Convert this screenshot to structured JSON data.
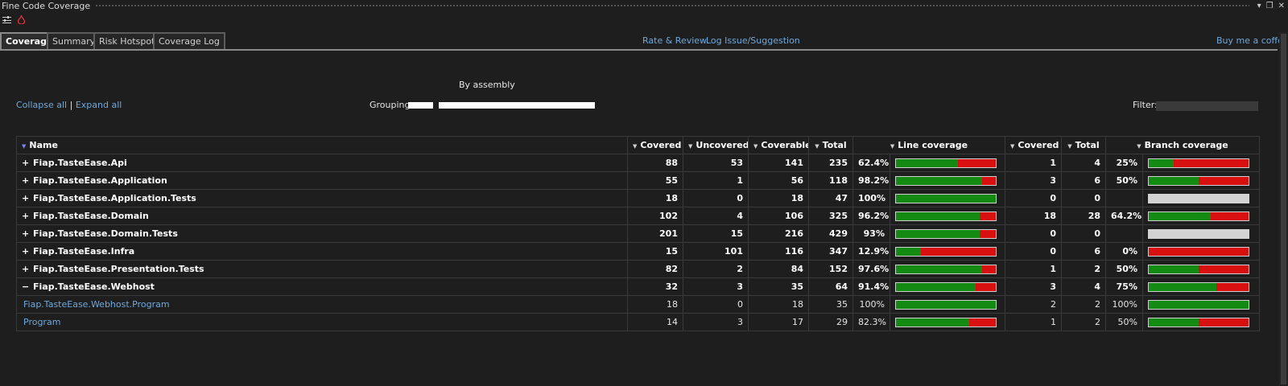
{
  "window": {
    "title": "Fine Code Coverage"
  },
  "tabs": [
    {
      "label": "Coverage",
      "active": true
    },
    {
      "label": "Summary"
    },
    {
      "label": "Risk Hotspots"
    },
    {
      "label": "Coverage Log"
    }
  ],
  "links": {
    "rate_review": "Rate & Review",
    "log_issue": "Log Issue/Suggestion",
    "buy_coffee": "Buy me a coffee"
  },
  "grouping": {
    "by_assembly": "By assembly",
    "collapse_all": "Collapse all",
    "separator": "|",
    "expand_all": "Expand all",
    "label": "Grouping:"
  },
  "filter": {
    "label": "Filter:"
  },
  "table": {
    "headers": {
      "name": "Name",
      "covered": "Covered",
      "uncovered": "Uncovered",
      "coverable": "Coverable",
      "total": "Total",
      "line_coverage": "Line coverage",
      "branch_covered": "Covered",
      "branch_total": "Total",
      "branch_coverage": "Branch coverage"
    },
    "rows": [
      {
        "type": "assembly",
        "expander": "+",
        "name": "Fiap.TasteEase.Api",
        "covered": "88",
        "uncovered": "53",
        "coverable": "141",
        "total": "235",
        "line_pct": "62.4%",
        "line_frac": 0.624,
        "br_covered": "1",
        "br_total": "4",
        "br_pct": "25%",
        "br_frac": 0.25
      },
      {
        "type": "assembly",
        "expander": "+",
        "name": "Fiap.TasteEase.Application",
        "covered": "55",
        "uncovered": "1",
        "coverable": "56",
        "total": "118",
        "line_pct": "98.2%",
        "line_frac": 0.86,
        "br_covered": "3",
        "br_total": "6",
        "br_pct": "50%",
        "br_frac": 0.5
      },
      {
        "type": "assembly",
        "expander": "+",
        "name": "Fiap.TasteEase.Application.Tests",
        "covered": "18",
        "uncovered": "0",
        "coverable": "18",
        "total": "47",
        "line_pct": "100%",
        "line_frac": 1.0,
        "br_covered": "0",
        "br_total": "0",
        "br_pct": "",
        "br_frac": null
      },
      {
        "type": "assembly",
        "expander": "+",
        "name": "Fiap.TasteEase.Domain",
        "covered": "102",
        "uncovered": "4",
        "coverable": "106",
        "total": "325",
        "line_pct": "96.2%",
        "line_frac": 0.84,
        "br_covered": "18",
        "br_total": "28",
        "br_pct": "64.2%",
        "br_frac": 0.62
      },
      {
        "type": "assembly",
        "expander": "+",
        "name": "Fiap.TasteEase.Domain.Tests",
        "covered": "201",
        "uncovered": "15",
        "coverable": "216",
        "total": "429",
        "line_pct": "93%",
        "line_frac": 0.84,
        "br_covered": "0",
        "br_total": "0",
        "br_pct": "",
        "br_frac": null
      },
      {
        "type": "assembly",
        "expander": "+",
        "name": "Fiap.TasteEase.Infra",
        "covered": "15",
        "uncovered": "101",
        "coverable": "116",
        "total": "347",
        "line_pct": "12.9%",
        "line_frac": 0.25,
        "br_covered": "0",
        "br_total": "6",
        "br_pct": "0%",
        "br_frac": 0
      },
      {
        "type": "assembly",
        "expander": "+",
        "name": "Fiap.TasteEase.Presentation.Tests",
        "covered": "82",
        "uncovered": "2",
        "coverable": "84",
        "total": "152",
        "line_pct": "97.6%",
        "line_frac": 0.86,
        "br_covered": "1",
        "br_total": "2",
        "br_pct": "50%",
        "br_frac": 0.5
      },
      {
        "type": "assembly",
        "expander": "−",
        "name": "Fiap.TasteEase.Webhost",
        "covered": "32",
        "uncovered": "3",
        "coverable": "35",
        "total": "64",
        "line_pct": "91.4%",
        "line_frac": 0.8,
        "br_covered": "3",
        "br_total": "4",
        "br_pct": "75%",
        "br_frac": 0.68
      },
      {
        "type": "class",
        "expander": "",
        "name": "Fiap.TasteEase.Webhost.Program",
        "covered": "18",
        "uncovered": "0",
        "coverable": "18",
        "total": "35",
        "line_pct": "100%",
        "line_frac": 1.0,
        "br_covered": "2",
        "br_total": "2",
        "br_pct": "100%",
        "br_frac": 1.0
      },
      {
        "type": "class",
        "expander": "",
        "name": "Program",
        "covered": "14",
        "uncovered": "3",
        "coverable": "17",
        "total": "29",
        "line_pct": "82.3%",
        "line_frac": 0.73,
        "br_covered": "1",
        "br_total": "2",
        "br_pct": "50%",
        "br_frac": 0.5
      }
    ]
  },
  "colors": {
    "covered": "#138b13",
    "uncovered": "#d81010",
    "no_branches": "#d3d3d3",
    "link": "#6fa8dc",
    "background": "#1e1e1e"
  }
}
